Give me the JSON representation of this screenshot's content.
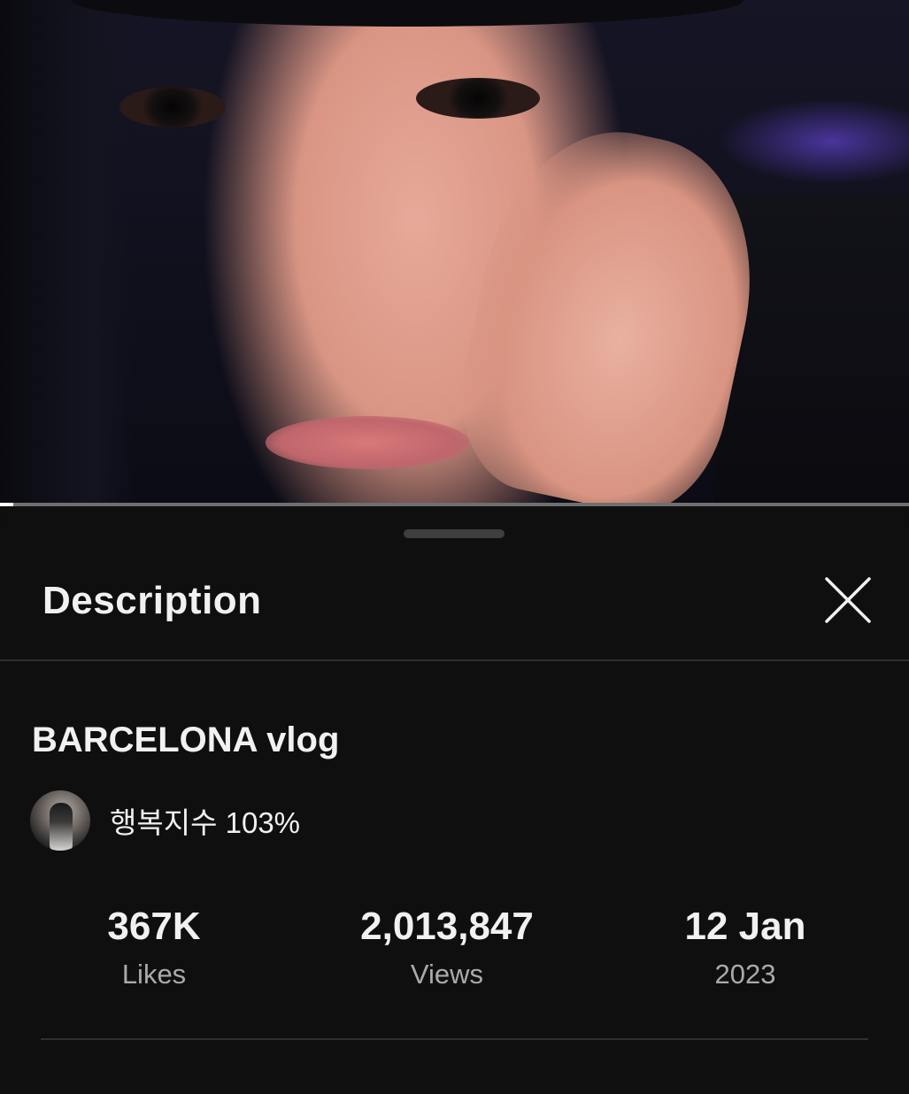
{
  "player": {
    "progress_fraction": 0.015
  },
  "sheet": {
    "title": "Description",
    "close_icon": "close-icon"
  },
  "video": {
    "title": "BARCELONA vlog"
  },
  "channel": {
    "name": "행복지수 103%"
  },
  "stats": {
    "likes": {
      "value": "367K",
      "label": "Likes"
    },
    "views": {
      "value": "2,013,847",
      "label": "Views"
    },
    "date": {
      "value": "12 Jan",
      "label": "2023"
    }
  },
  "colors": {
    "background": "#0f0f0f",
    "primary_text": "#f1f1f1",
    "secondary_text": "#aaaaaa",
    "divider": "#303030"
  }
}
